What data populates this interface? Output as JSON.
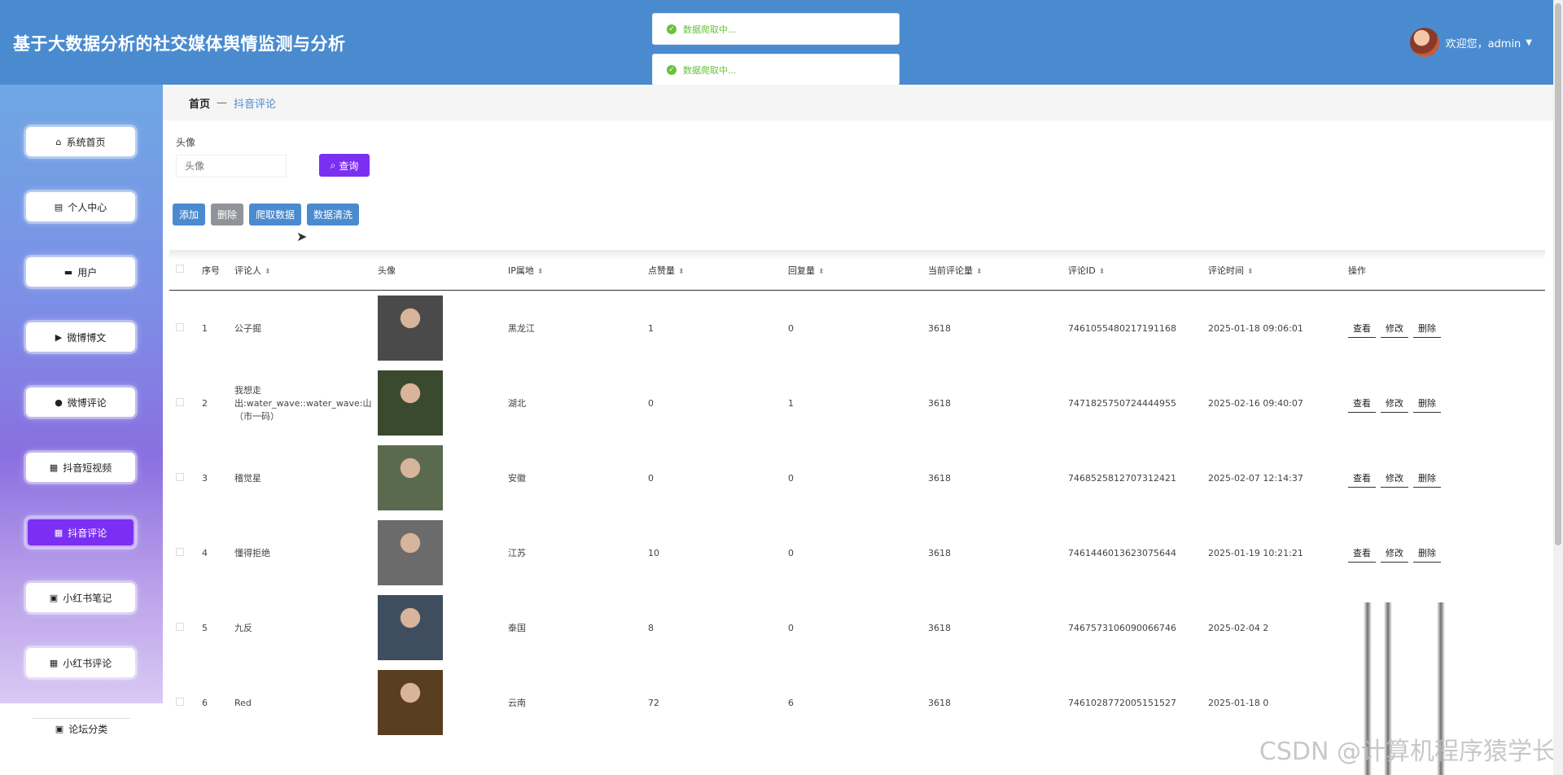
{
  "header": {
    "title": "基于大数据分析的社交媒体舆情监测与分析",
    "welcome": "欢迎您，admin"
  },
  "toasts": [
    "数据爬取中...",
    "数据爬取中..."
  ],
  "sidebar": {
    "items": [
      {
        "label": "系统首页",
        "icon": "home-icon"
      },
      {
        "label": "个人中心",
        "icon": "card-icon"
      },
      {
        "label": "用户",
        "icon": "monitor-icon"
      },
      {
        "label": "微博博文",
        "icon": "video-icon"
      },
      {
        "label": "微博评论",
        "icon": "user-icon"
      },
      {
        "label": "抖音短视频",
        "icon": "grid-icon"
      },
      {
        "label": "抖音评论",
        "icon": "grid-icon",
        "active": true
      },
      {
        "label": "小红书笔记",
        "icon": "clipboard-icon"
      },
      {
        "label": "小红书评论",
        "icon": "grid-icon"
      },
      {
        "label": "论坛分类",
        "icon": "clipboard-icon"
      }
    ]
  },
  "breadcrumb": {
    "home": "首页",
    "sep": "—",
    "current": "抖音评论"
  },
  "search": {
    "label": "头像",
    "placeholder": "头像",
    "button": "查询"
  },
  "actions": {
    "add": "添加",
    "delete": "删除",
    "crawl": "爬取数据",
    "clean": "数据清洗"
  },
  "table": {
    "headers": [
      "序号",
      "评论人",
      "头像",
      "IP属地",
      "点赞量",
      "回复量",
      "当前评论量",
      "评论ID",
      "评论时间",
      "操作"
    ],
    "rows": [
      {
        "no": "1",
        "user": "公子掘",
        "ip": "黑龙江",
        "likes": "1",
        "replies": "0",
        "count": "3618",
        "id": "7461055480217191168",
        "time": "2025-01-18 09:06:01",
        "avatar_color": "#4a4a4a"
      },
      {
        "no": "2",
        "user": "我想走出:water_wave::water_wave:山（市一码）",
        "ip": "湖北",
        "likes": "0",
        "replies": "1",
        "count": "3618",
        "id": "7471825750724444955",
        "time": "2025-02-16 09:40:07",
        "avatar_color": "#3a4a2e"
      },
      {
        "no": "3",
        "user": "稽觉星",
        "ip": "安徽",
        "likes": "0",
        "replies": "0",
        "count": "3618",
        "id": "7468525812707312421",
        "time": "2025-02-07 12:14:37",
        "avatar_color": "#5a6a4e"
      },
      {
        "no": "4",
        "user": "懂得拒绝",
        "ip": "江苏",
        "likes": "10",
        "replies": "0",
        "count": "3618",
        "id": "7461446013623075644",
        "time": "2025-01-19 10:21:21",
        "avatar_color": "#6b6b6b"
      },
      {
        "no": "5",
        "user": "九反",
        "ip": "泰国",
        "likes": "8",
        "replies": "0",
        "count": "3618",
        "id": "7467573106090066746",
        "time": "2025-02-04 2",
        "avatar_color": "#3e4e5e"
      },
      {
        "no": "6",
        "user": "Red",
        "ip": "云南",
        "likes": "72",
        "replies": "6",
        "count": "3618",
        "id": "7461028772005151527",
        "time": "2025-01-18 0",
        "avatar_color": "#5a3e22"
      }
    ],
    "ops": {
      "view": "查看",
      "edit": "修改",
      "delete": "删除"
    }
  },
  "watermark": "CSDN @计算机程序猿学长"
}
